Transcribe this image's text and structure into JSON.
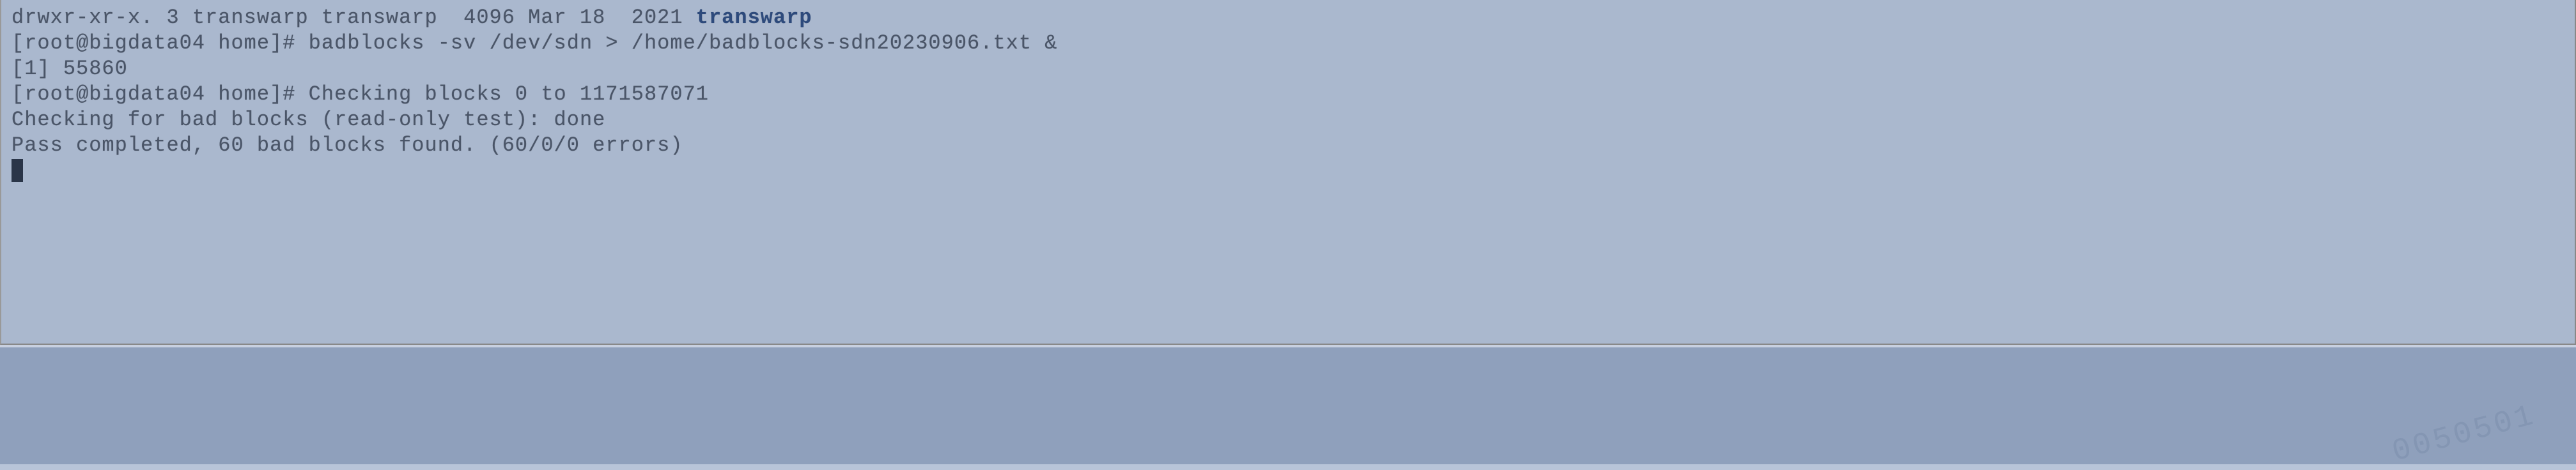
{
  "terminal": {
    "lines": [
      {
        "segments": [
          {
            "text": "drwxr-xr-x. 3 transwarp transwarp  4096 Mar 18  2021 ",
            "class": ""
          },
          {
            "text": "transwarp",
            "class": "highlight"
          }
        ]
      },
      {
        "segments": [
          {
            "text": "[root@bigdata04 home]# badblocks -sv /dev/sdn > /home/badblocks-sdn20230906.txt &",
            "class": ""
          }
        ]
      },
      {
        "segments": [
          {
            "text": "[1] 55860",
            "class": ""
          }
        ]
      },
      {
        "segments": [
          {
            "text": "[root@bigdata04 home]# Checking blocks 0 to 1171587071",
            "class": ""
          }
        ]
      },
      {
        "segments": [
          {
            "text": "Checking for bad blocks (read-only test): done",
            "class": ""
          }
        ]
      },
      {
        "segments": [
          {
            "text": "Pass completed, 60 bad blocks found. (60/0/0 errors)",
            "class": ""
          }
        ]
      }
    ],
    "prompt_user": "root",
    "prompt_host": "bigdata04",
    "prompt_cwd": "home",
    "command": "badblocks -sv /dev/sdn > /home/badblocks-sdn20230906.txt &",
    "job_id": "1",
    "job_pid": "55860",
    "ls_entry": {
      "permissions": "drwxr-xr-x.",
      "links": "3",
      "owner": "transwarp",
      "group": "transwarp",
      "size": "4096",
      "date": "Mar 18  2021",
      "name": "transwarp"
    },
    "badblocks_output": {
      "range_start": "0",
      "range_end": "1171587071",
      "test_type": "read-only test",
      "status": "done",
      "bad_blocks_found": "60",
      "errors_summary": "60/0/0"
    }
  },
  "watermark_text": "0050501"
}
